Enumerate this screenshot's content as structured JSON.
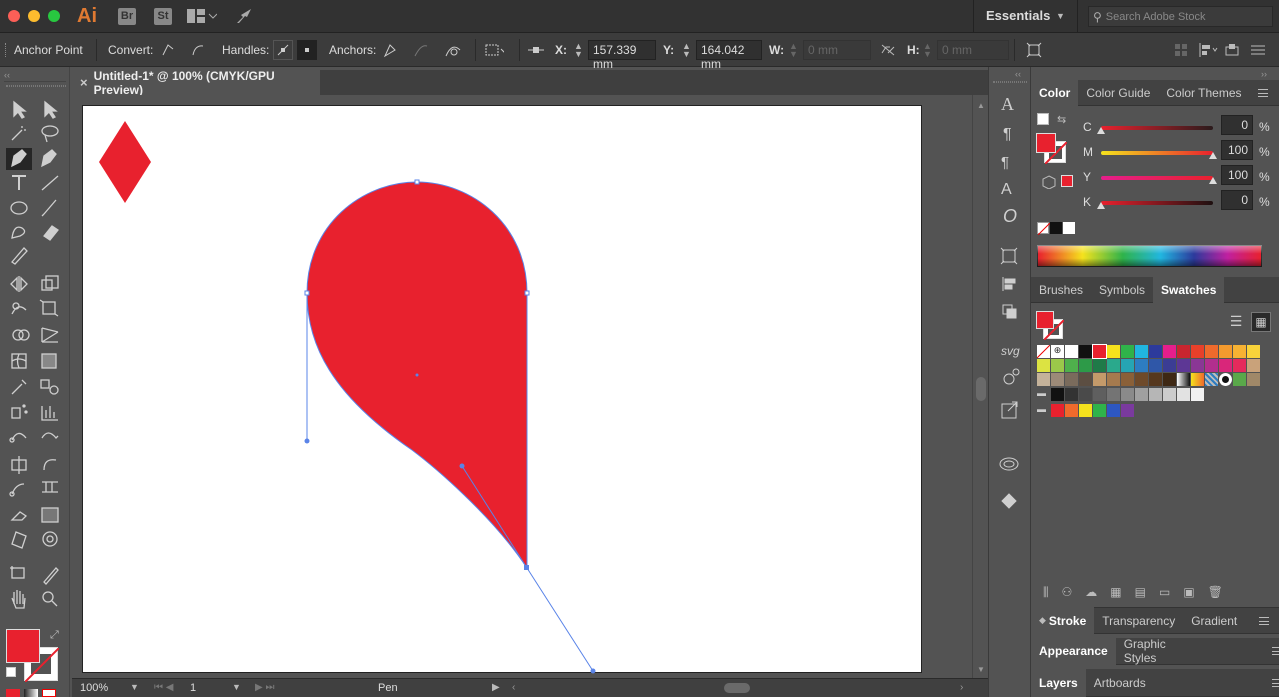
{
  "app": {
    "logo": "Ai",
    "bridge": "Br",
    "stock": "St"
  },
  "workspace": {
    "label": "Essentials",
    "search_placeholder": "Search Adobe Stock"
  },
  "controlbar": {
    "tool_name": "Anchor Point",
    "convert_label": "Convert:",
    "handles_label": "Handles:",
    "anchors_label": "Anchors:",
    "x_label": "X:",
    "x_value": "157.339 mm",
    "y_label": "Y:",
    "y_value": "164.042 mm",
    "w_label": "W:",
    "w_value": "0 mm",
    "h_label": "H:",
    "h_value": "0 mm"
  },
  "document": {
    "tab_title": "Untitled-1* @ 100% (CMYK/GPU Preview)",
    "close_glyph": "×"
  },
  "status": {
    "zoom": "100%",
    "artboard": "1",
    "tool": "Pen"
  },
  "colors": {
    "fill": "#e8212e",
    "path": "#5a84e8",
    "ui_bg": "#535353"
  },
  "color_panel": {
    "tabs": [
      "Color",
      "Color Guide",
      "Color Themes"
    ],
    "active_tab": "Color",
    "channels": [
      {
        "label": "C",
        "value": "0",
        "pct": 0
      },
      {
        "label": "M",
        "value": "100",
        "pct": 100
      },
      {
        "label": "Y",
        "value": "100",
        "pct": 100
      },
      {
        "label": "K",
        "value": "0",
        "pct": 0
      }
    ],
    "unit": "%"
  },
  "swatches_panel": {
    "tabs": [
      "Brushes",
      "Symbols",
      "Swatches"
    ],
    "active_tab": "Swatches"
  },
  "bottom_panels": {
    "group1": [
      "Stroke",
      "Transparency",
      "Gradient"
    ],
    "group2": [
      "Appearance",
      "Graphic Styles"
    ],
    "group3": [
      "Layers",
      "Artboards"
    ]
  }
}
